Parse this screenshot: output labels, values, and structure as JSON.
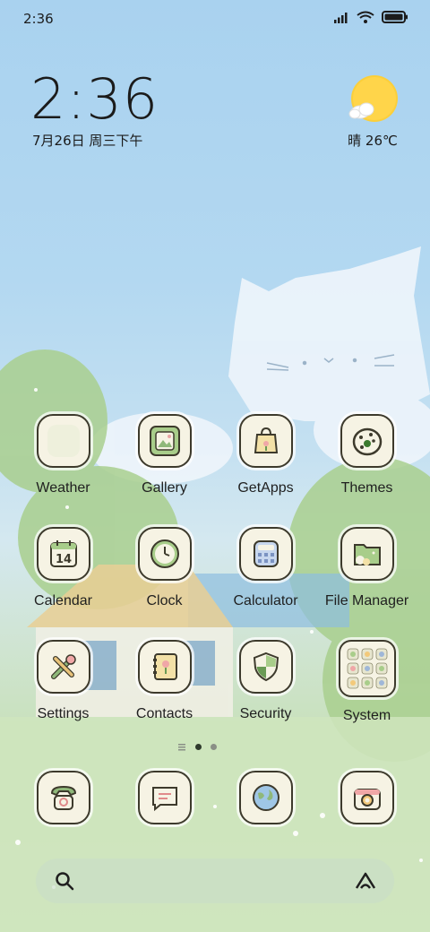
{
  "status_bar": {
    "time": "2:36"
  },
  "clock_widget": {
    "time": "2:36",
    "date": "7月26日 周三下午"
  },
  "weather_widget": {
    "condition_temp": "晴 26℃",
    "icon": "sun-cloud-icon"
  },
  "apps": [
    {
      "label": "Weather",
      "icon": "weather-icon"
    },
    {
      "label": "Gallery",
      "icon": "gallery-icon"
    },
    {
      "label": "GetApps",
      "icon": "getapps-icon"
    },
    {
      "label": "Themes",
      "icon": "themes-icon"
    },
    {
      "label": "Calendar",
      "icon": "calendar-icon",
      "badge": "14"
    },
    {
      "label": "Clock",
      "icon": "clock-icon"
    },
    {
      "label": "Calculator",
      "icon": "calculator-icon"
    },
    {
      "label": "File Manager",
      "icon": "file-manager-icon"
    },
    {
      "label": "Settings",
      "icon": "settings-icon"
    },
    {
      "label": "Contacts",
      "icon": "contacts-icon"
    },
    {
      "label": "Security",
      "icon": "security-icon"
    },
    {
      "label": "System",
      "icon": "system-folder-icon"
    }
  ],
  "dock": [
    {
      "icon": "phone-icon"
    },
    {
      "icon": "messages-icon"
    },
    {
      "icon": "browser-icon"
    },
    {
      "icon": "camera-icon"
    }
  ],
  "pager": {
    "pages": 2,
    "current": 1
  }
}
